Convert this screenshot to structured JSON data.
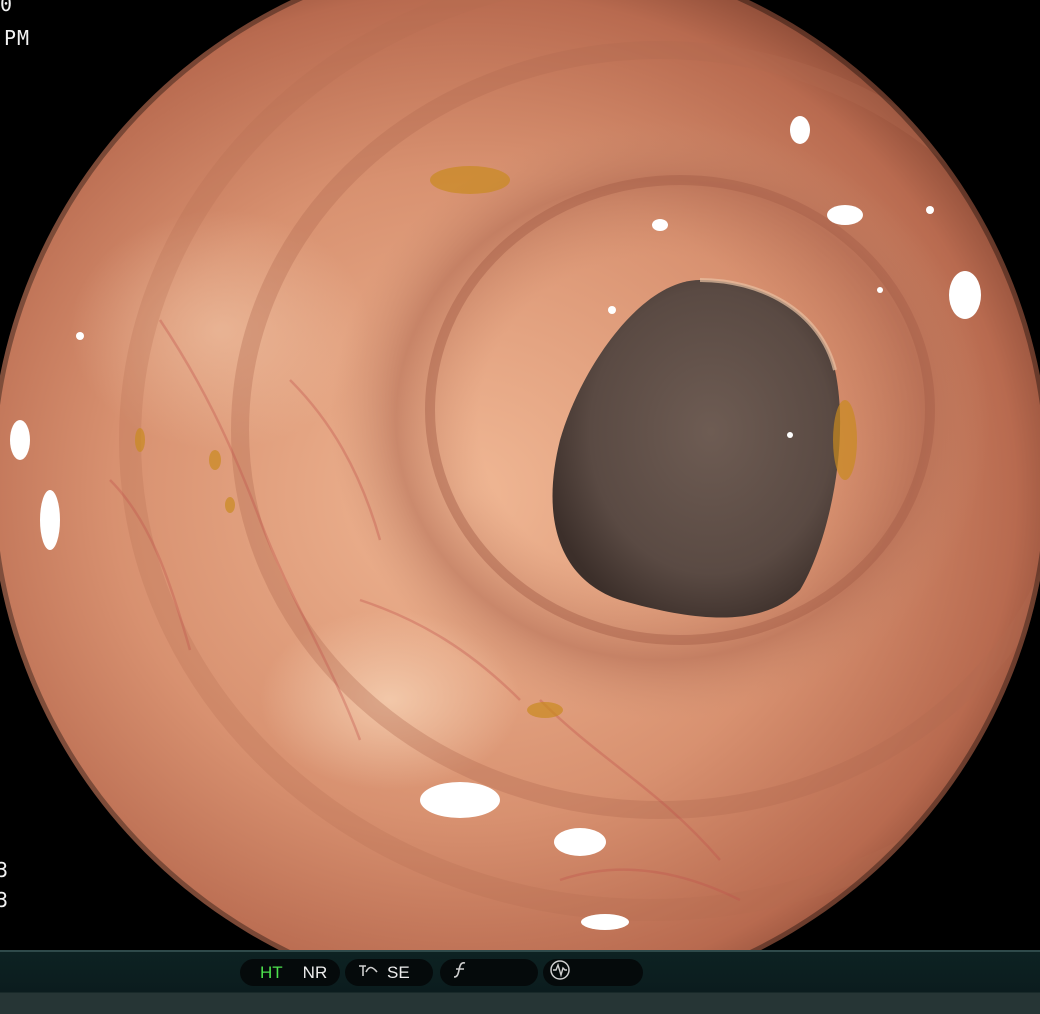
{
  "overlay": {
    "time_top_fragment": "0",
    "time_ampm": "PM",
    "left_bottom_1": "3",
    "left_bottom_2": "3"
  },
  "status_bar": {
    "ht_label": "HT",
    "nr_label": "NR",
    "se_label": "SE",
    "colors": {
      "ht_active": "#4de04d",
      "inactive": "#ededed"
    },
    "icons": [
      "enhancement-curve-icon",
      "f-function-icon",
      "waveform-circle-icon"
    ]
  }
}
